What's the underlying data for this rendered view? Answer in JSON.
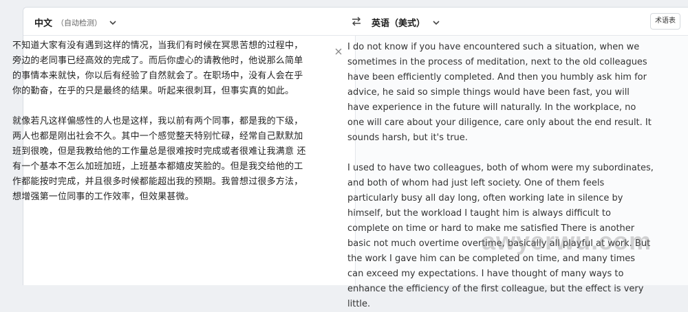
{
  "header": {
    "source_lang": "中文",
    "source_mode": "（自动检测）",
    "target_lang": "英语（美式）",
    "glossary_label": "术语表"
  },
  "source": {
    "text": "不知道大家有没有遇到这样的情况，当我们有时候在冥思苦想的过程中，旁边的老同事已经高效的完成了。而后你虚心的请教他时，他说那么简单的事情本来就快，你以后有经验了自然就会了。在职场中，没有人会在乎你的勤奋，在乎的只是最终的结果。听起来很刺耳，但事实真的如此。\n\n就像若凡这样偏感性的人也是这样，我以前有两个同事，都是我的下级，两人也都是刚出社会不久。其中一个感觉整天特别忙碌，经常自己默默加班到很晚，但是我教给他的工作量总是很难按时完成或者很难让我满意 还有一个基本不怎么加班加班，上班基本都嬉皮笑脸的。但是我交给他的工作都能按时完成，并且很多时候都能超出我的预期。我曾想过很多方法，想增强第一位同事的工作效率，但效果甚微。"
  },
  "target": {
    "text": "I do not know if you have encountered such a situation, when we sometimes in the process of meditation, next to the old colleagues have been efficiently completed. And then you humbly ask him for advice, he said so simple things would have been fast, you will have experience in the future will naturally. In the workplace, no one will care about your diligence, care only about the end result. It sounds harsh, but it's true.\n\nI used to have two colleagues, both of whom were my subordinates, and both of whom had just left society. One of them feels particularly busy all day long, often working late in silence by himself, but the workload I taught him is always difficult to complete on time or hard to make me satisfied There is another basic not much overtime overtime, basically all playful at work. But the work I gave him can be completed on time, and many times can exceed my expectations. I have thought of many ways to enhance the efficiency of the first colleague, but the effect is very little."
  },
  "watermark": "awyerwu.com",
  "colors": {
    "accent": "#1a1a1a",
    "border": "#e4e7eb"
  },
  "icons": [
    "chevron-down-icon",
    "swap-icon",
    "close-icon"
  ]
}
